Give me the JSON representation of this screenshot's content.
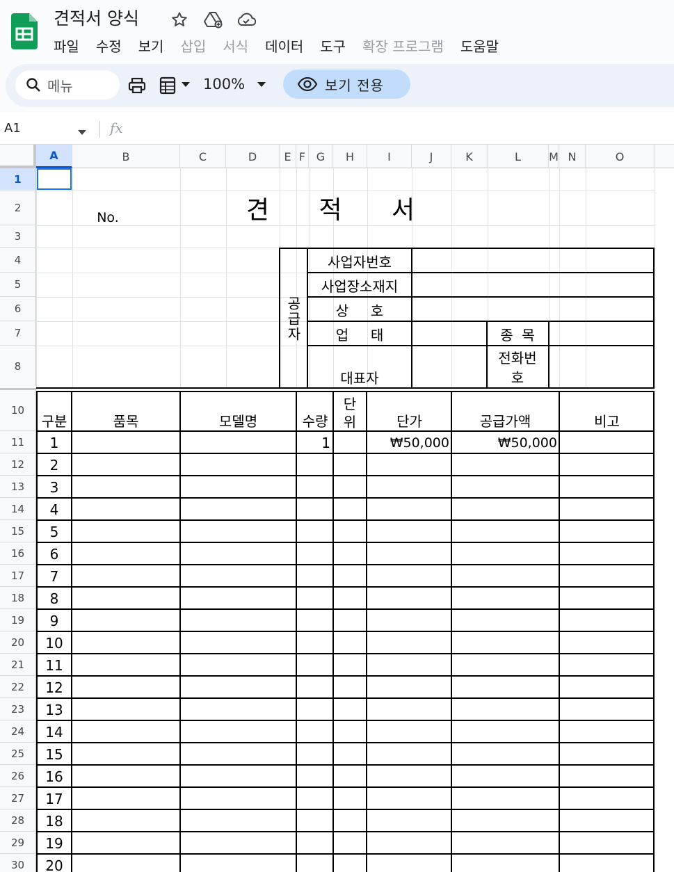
{
  "app": {
    "doc_title": "견적서 양식"
  },
  "menu": [
    "파일",
    "수정",
    "보기",
    "삽입",
    "서식",
    "데이터",
    "도구",
    "확장 프로그램",
    "도움말"
  ],
  "menu_disabled": [
    false,
    false,
    false,
    true,
    true,
    false,
    false,
    true,
    false
  ],
  "toolbar": {
    "menu_search_label": "메뉴",
    "zoom": "100%",
    "view_only_label": "보기 전용"
  },
  "formula_bar": {
    "name_box": "A1",
    "fx": "fx"
  },
  "columns": [
    "A",
    "B",
    "C",
    "D",
    "E",
    "F",
    "G",
    "H",
    "I",
    "J",
    "K",
    "L",
    "M",
    "N",
    "O"
  ],
  "active_column": "A",
  "row_numbers": [
    "1",
    "2",
    "3",
    "4",
    "5",
    "6",
    "7",
    "8",
    "10",
    "11",
    "12",
    "13",
    "14",
    "15",
    "16",
    "17",
    "18",
    "19",
    "20",
    "21",
    "22",
    "23",
    "24",
    "25",
    "26",
    "27",
    "28",
    "29",
    "30"
  ],
  "active_row": "1",
  "sheet": {
    "no_label": "No.",
    "title": "견 적 서",
    "supplier": {
      "label": "공급자",
      "business_number": "사업자번호",
      "business_address": "사업장소재지",
      "company_name": "상     호",
      "business_type": "업     태",
      "business_item": "종  목",
      "phone": "전화번",
      "phone_line2": "호",
      "representative": "대표자"
    },
    "table": {
      "headers": {
        "category": "구분",
        "item": "품목",
        "model": "모델명",
        "quantity": "수량",
        "unit": "단",
        "unit_line2": "위",
        "unit_price": "단가",
        "supply_amount": "공급가액",
        "note": "비고"
      },
      "rows": [
        {
          "no": "1",
          "quantity": "1",
          "unit_price": "₩50,000",
          "supply_amount": "₩50,000"
        },
        {
          "no": "2"
        },
        {
          "no": "3"
        },
        {
          "no": "4"
        },
        {
          "no": "5"
        },
        {
          "no": "6"
        },
        {
          "no": "7"
        },
        {
          "no": "8"
        },
        {
          "no": "9"
        },
        {
          "no": "10"
        },
        {
          "no": "11"
        },
        {
          "no": "12"
        },
        {
          "no": "13"
        },
        {
          "no": "14"
        },
        {
          "no": "15"
        },
        {
          "no": "16"
        },
        {
          "no": "17"
        },
        {
          "no": "18"
        },
        {
          "no": "19"
        },
        {
          "no": "20"
        }
      ]
    }
  },
  "colors": {
    "accent": "#1a73e8",
    "sheets_green": "#0f9d58",
    "view_only_bg": "#c2dcfb"
  },
  "icons": [
    "sheets-logo-icon",
    "star-icon",
    "move-to-drive-icon",
    "cloud-status-icon",
    "search-icon",
    "print-icon",
    "paint-format-icon",
    "chevron-down-icon",
    "eye-icon",
    "fx-icon"
  ]
}
